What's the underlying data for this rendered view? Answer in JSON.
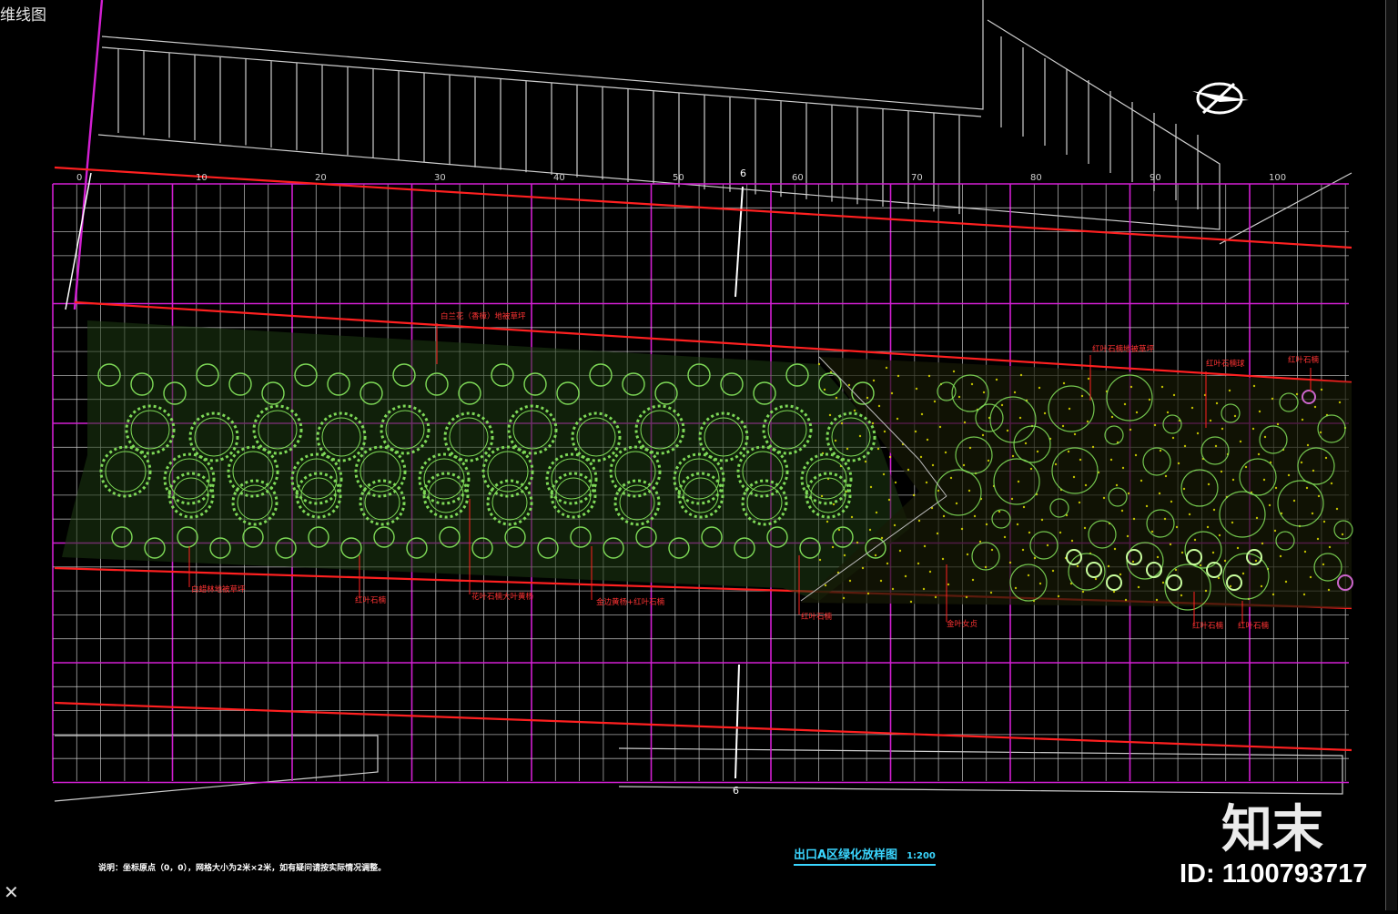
{
  "viewport": {
    "title": "维线图"
  },
  "drawing": {
    "title": "出口A区绿化放样图",
    "scale": "1:200",
    "note": "说明：坐标原点（0，0），网格大小为2米×2米，如有疑问请按实际情况调整。",
    "axis_top_labels": [
      "0",
      "10",
      "20",
      "30",
      "40",
      "50",
      "60",
      "70",
      "80",
      "90",
      "100"
    ],
    "section_marker_top": "6",
    "section_marker_bottom": "6",
    "plant_callouts": [
      "白兰花（香樟）地被草坪",
      "白蜡林地被草坪",
      "红叶石楠",
      "花叶石楠大叶黄杨",
      "金边黄杨+红叶石楠",
      "红叶石楠",
      "金叶女贞",
      "红叶石楠",
      "红叶石楠",
      "红叶石楠地被草坪",
      "红叶石楠球",
      "红叶石楠"
    ],
    "colors": {
      "major_grid": "#d21fd2",
      "minor_grid": "#c8c8c8",
      "road_line": "#ff2020",
      "plant": "#7ed957",
      "dots": "#e8e800",
      "title": "#3ad6ff"
    }
  },
  "watermark": {
    "brand": "知末",
    "id_text": "ID: 1100793717"
  }
}
